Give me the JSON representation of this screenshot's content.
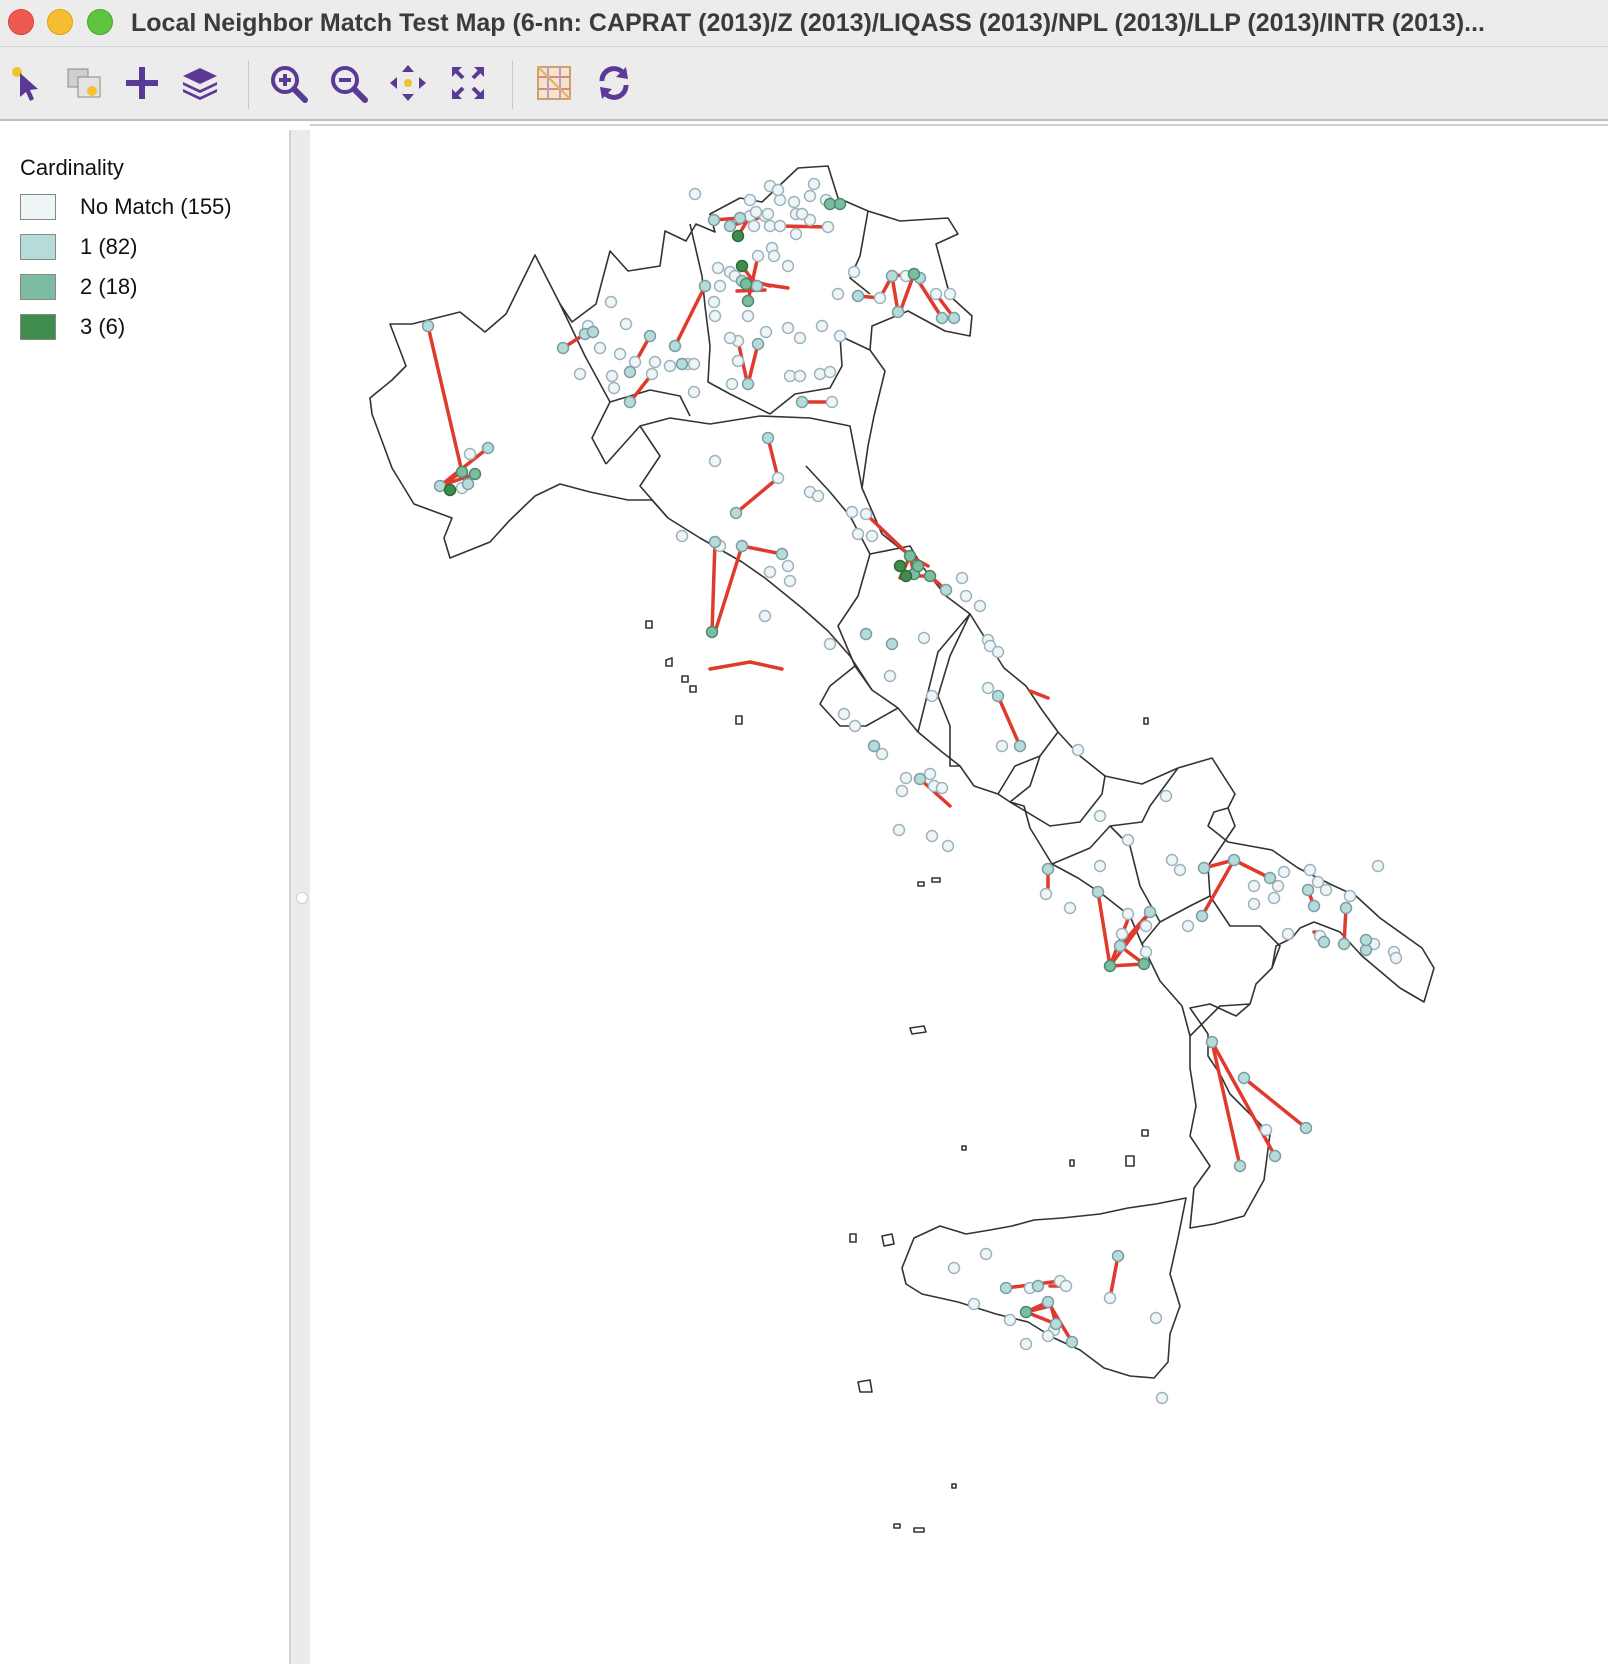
{
  "window": {
    "title": "Local Neighbor Match Test Map (6-nn: CAPRAT (2013)/Z (2013)/LIQASS (2013)/NPL (2013)/LLP (2013)/INTR (2013)..."
  },
  "toolbar": {
    "buttons": [
      {
        "name": "select-tool-icon"
      },
      {
        "name": "copy-image-icon"
      },
      {
        "name": "add-layer-icon"
      },
      {
        "name": "layers-icon"
      },
      {
        "name": "zoom-in-icon"
      },
      {
        "name": "zoom-out-icon"
      },
      {
        "name": "pan-icon"
      },
      {
        "name": "full-extent-icon"
      },
      {
        "name": "basemap-icon"
      },
      {
        "name": "refresh-icon"
      }
    ],
    "icon_color": "#5b3a95"
  },
  "legend": {
    "title": "Cardinality",
    "items": [
      {
        "label": "No Match (155)",
        "color": "#eef5f7"
      },
      {
        "label": "1 (82)",
        "color": "#b6dcd9"
      },
      {
        "label": "2 (18)",
        "color": "#7cbda2"
      },
      {
        "label": "3 (6)",
        "color": "#3f8d4c"
      }
    ]
  },
  "map": {
    "link_color": "#e03a2c",
    "outline_color": "#333333",
    "point_classes": {
      "no_match": {
        "fill": "#eef5f7",
        "stroke": "#9fb3bd"
      },
      "c1": {
        "fill": "#b6dcd9",
        "stroke": "#7c9ca6"
      },
      "c2": {
        "fill": "#7cbda2",
        "stroke": "#4c8a6f"
      },
      "c3": {
        "fill": "#3f8d4c",
        "stroke": "#2d6b38"
      }
    }
  }
}
